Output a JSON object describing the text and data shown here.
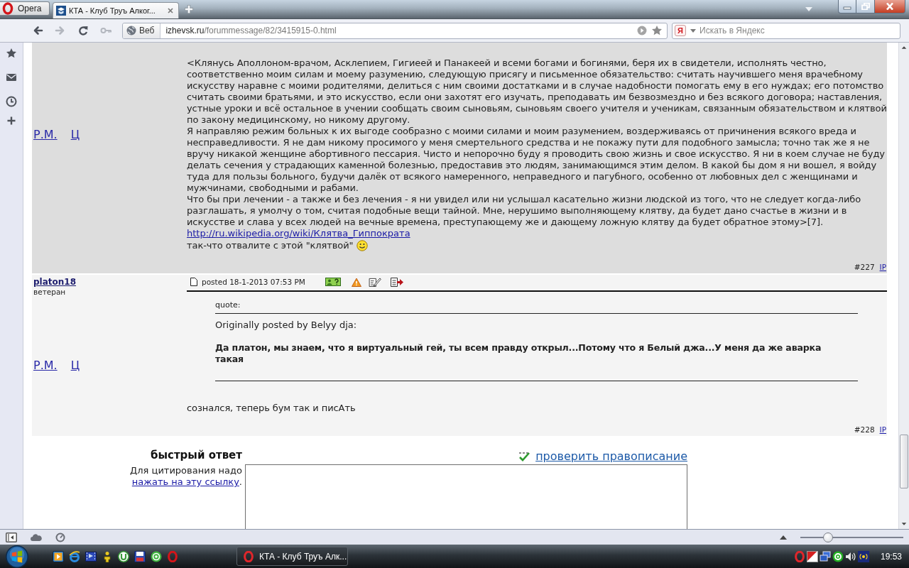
{
  "browser": {
    "menu_button": "Opera",
    "tabs": [
      {
        "title": "КТА - Клуб Труъ Алког...",
        "selected": true
      }
    ],
    "nav_buttons": [
      {
        "kind": "back",
        "disabled": false
      },
      {
        "kind": "forward",
        "disabled": true
      },
      {
        "kind": "reload",
        "disabled": false
      },
      {
        "kind": "key",
        "disabled": true
      }
    ],
    "address": {
      "badge": "Веб",
      "domain": "izhevsk.ru",
      "path": "/forummessage/82/3415915-0.html"
    },
    "search": {
      "engine_logo": "Я",
      "placeholder": "Искать в Яндекс"
    }
  },
  "posts": [
    {
      "side_links": [
        "Р.М.",
        "Ц"
      ],
      "paragraphs": [
        "<Клянусь Аполлоном-врачом, Асклепием, Гигиеей и Панакеей и всеми богами и богинями, беря их в свидетели, исполнять честно, соответственно моим силам и моему разумению, следующую присягу и письменное обязательство: считать научившего меня врачебному искусству наравне с моими родителями, делиться с ним своими достатками и в случае надобности помогать ему в его нуждах; его потомство считать своими братьями, и это искусство, если они захотят его изучать, преподавать им безвозмездно и без всякого договора; наставления, устные уроки и всё остальное в учении сообщать своим сыновьям, сыновьям своего учителя и ученикам, связанным обязательством и клятвой по закону медицинскому, но никому другому.",
        "Я направляю режим больных к их выгоде сообразно с моими силами и моим разумением, воздерживаясь от причинения всякого вреда и несправедливости. Я не дам никому просимого у меня смертельного средства и не покажу пути для подобного замысла; точно так же я не вручу никакой женщине абортивного пессария. Чисто и непорочно буду я проводить свою жизнь и свое искусство. Я ни в коем случае не буду делать сечения у страдающих каменной болезнью, предоставив это людям, занимающимся этим делом. В какой бы дом я ни вошел, я войду туда для пользы больного, будучи далёк от всякого намеренного, неправедного и пагубного, особенно от любовных дел с женщинами и мужчинами, свободными и рабами.",
        "Что бы при лечении - а также и без лечения - я ни увидел или ни услышал касательно жизни людской из того, что не следует когда-либо разглашать, я умолчу о том, считая подобные вещи тайной. Мне, нерушимо выполняющему клятву, да будет дано счастье в жизни и в искусстве и слава у всех людей на вечные времена, преступающему же и дающему ложную клятву да будет обратное этому>[7]."
      ],
      "link": "http://ru.wikipedia.org/wiki/Клятва_Гиппократа",
      "closing": "так-что отвалите с этой \"клятвой\"",
      "number": "#227",
      "ip": "IP"
    },
    {
      "author": "platon18",
      "rank": "ветеран",
      "side_links": [
        "Р.М.",
        "Ц"
      ],
      "posted": "posted 18-1-2013 07:53 PM",
      "quote": {
        "label": "quote:",
        "attribution": "Originally posted by Belyy dja:",
        "text": "Да платон, мы знаем, что я виртуальный гей, ты всем правду открыл...Потому что я Белый джа...У меня да же аварка такая"
      },
      "paragraphs": [
        "сознался, теперь бум так и писАть"
      ],
      "number": "#228",
      "ip": "IP"
    }
  ],
  "quick_reply": {
    "title": "быстрый ответ",
    "hint": "Для цитирования надо",
    "hint_link": "нажать на эту ссылку",
    "hint_end": ".",
    "spellcheck": "проверить правописание"
  },
  "status_bar": {
    "zoom": {
      "level": 0.27
    }
  },
  "taskbar": {
    "task": {
      "title": "КТА - Клуб Труъ Алк..."
    },
    "clock": "19:53"
  }
}
